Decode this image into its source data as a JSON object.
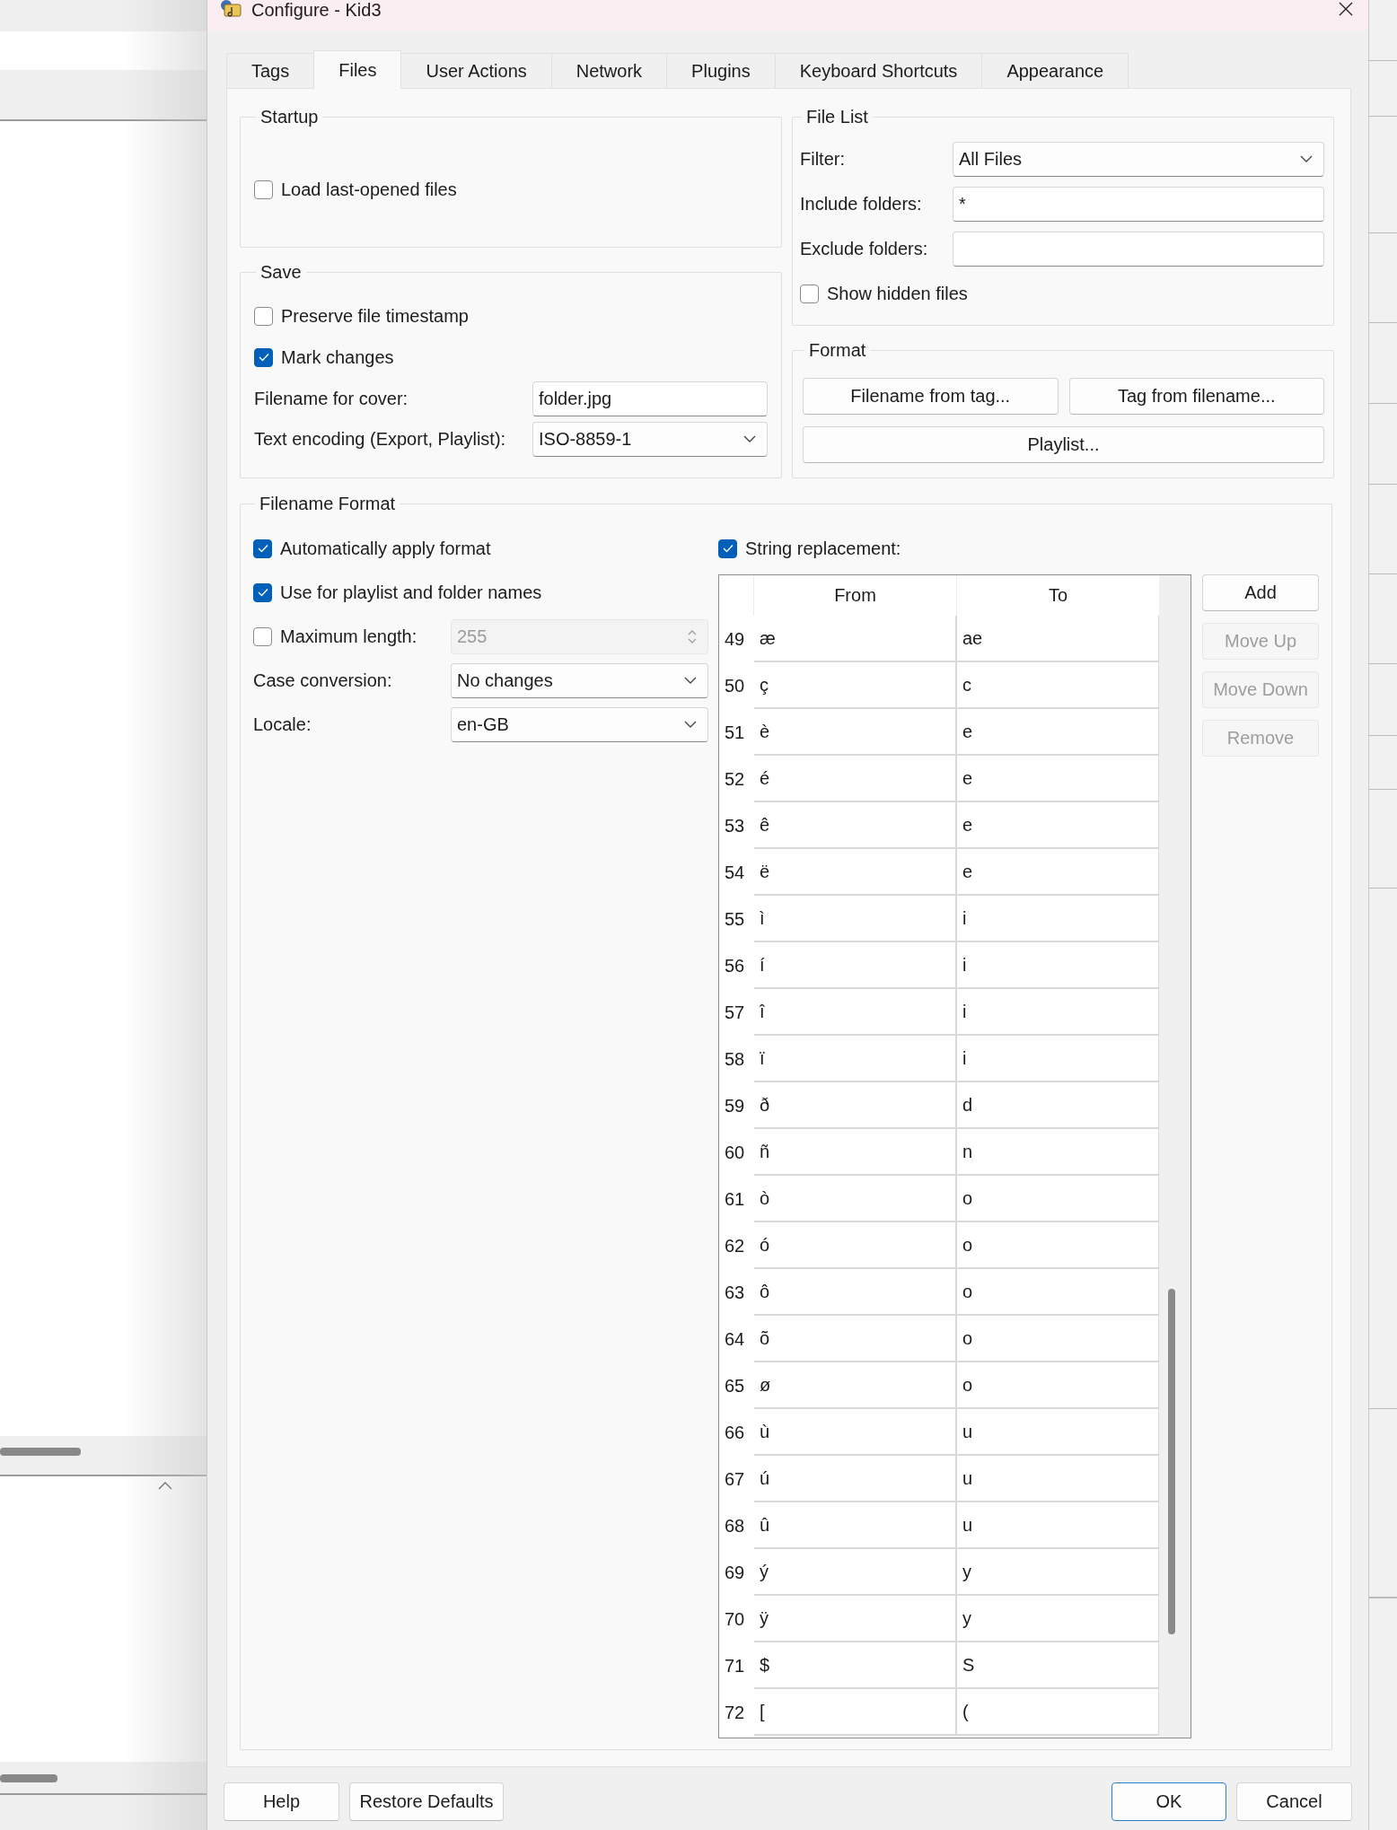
{
  "window": {
    "title": "Configure - Kid3"
  },
  "tabs": [
    {
      "label": "Tags",
      "selected": false
    },
    {
      "label": "Files",
      "selected": true
    },
    {
      "label": "User Actions",
      "selected": false
    },
    {
      "label": "Network",
      "selected": false
    },
    {
      "label": "Plugins",
      "selected": false
    },
    {
      "label": "Keyboard Shortcuts",
      "selected": false
    },
    {
      "label": "Appearance",
      "selected": false
    }
  ],
  "startup": {
    "title": "Startup",
    "options": [
      {
        "label": "Load last-opened files",
        "checked": false
      }
    ]
  },
  "save": {
    "title": "Save",
    "options": [
      {
        "label": "Preserve file timestamp",
        "checked": false
      },
      {
        "label": "Mark changes",
        "checked": true
      }
    ],
    "fields": [
      {
        "label": "Filename for cover:",
        "kind": "text",
        "value": "folder.jpg"
      },
      {
        "label": "Text encoding (Export, Playlist):",
        "kind": "combo",
        "value": "ISO-8859-1"
      }
    ]
  },
  "file_list": {
    "title": "File List",
    "fields": [
      {
        "label": "Filter:",
        "kind": "combo",
        "value": "All Files"
      },
      {
        "label": "Include folders:",
        "kind": "text",
        "value": "*"
      },
      {
        "label": "Exclude folders:",
        "kind": "text"
      }
    ],
    "options": [
      {
        "label": "Show hidden files",
        "checked": false
      }
    ]
  },
  "format": {
    "title": "Format",
    "buttons": [
      "Filename from tag...",
      "Tag from filename...",
      "Playlist..."
    ]
  },
  "filename_format": {
    "title": "Filename Format",
    "options": [
      {
        "label": "Automatically apply format",
        "checked": true
      },
      {
        "label": "Use for playlist and folder names",
        "checked": true
      }
    ],
    "max_length": {
      "label": "Maximum length:",
      "checked": false,
      "value": "255",
      "disabled": true
    },
    "fields": [
      {
        "label": "Case conversion:",
        "kind": "combo",
        "value": "No changes"
      },
      {
        "label": "Locale:",
        "kind": "combo",
        "value": "en-GB"
      }
    ],
    "string_replacement": {
      "label": "String replacement:",
      "checked": true,
      "columns": [
        "From",
        "To"
      ],
      "rows": [
        {
          "number": "49",
          "from": "æ",
          "to": "ae"
        },
        {
          "number": "50",
          "from": "ç",
          "to": "c"
        },
        {
          "number": "51",
          "from": "è",
          "to": "e"
        },
        {
          "number": "52",
          "from": "é",
          "to": "e"
        },
        {
          "number": "53",
          "from": "ê",
          "to": "e"
        },
        {
          "number": "54",
          "from": "ë",
          "to": "e"
        },
        {
          "number": "55",
          "from": "ì",
          "to": "i"
        },
        {
          "number": "56",
          "from": "í",
          "to": "i"
        },
        {
          "number": "57",
          "from": "î",
          "to": "i"
        },
        {
          "number": "58",
          "from": "ï",
          "to": "i"
        },
        {
          "number": "59",
          "from": "ð",
          "to": "d"
        },
        {
          "number": "60",
          "from": "ñ",
          "to": "n"
        },
        {
          "number": "61",
          "from": "ò",
          "to": "o"
        },
        {
          "number": "62",
          "from": "ó",
          "to": "o"
        },
        {
          "number": "63",
          "from": "ô",
          "to": "o"
        },
        {
          "number": "64",
          "from": "õ",
          "to": "o"
        },
        {
          "number": "65",
          "from": "ø",
          "to": "o"
        },
        {
          "number": "66",
          "from": "ù",
          "to": "u"
        },
        {
          "number": "67",
          "from": "ú",
          "to": "u"
        },
        {
          "number": "68",
          "from": "û",
          "to": "u"
        },
        {
          "number": "69",
          "from": "ý",
          "to": "y"
        },
        {
          "number": "70",
          "from": "ÿ",
          "to": "y"
        },
        {
          "number": "71",
          "from": "$",
          "to": "S"
        },
        {
          "number": "72",
          "from": "[",
          "to": "("
        }
      ]
    },
    "buttons": [
      {
        "label": "Add",
        "disabled": false
      },
      {
        "label": "Move Up",
        "disabled": true
      },
      {
        "label": "Move Down",
        "disabled": true
      },
      {
        "label": "Remove",
        "disabled": true
      }
    ]
  },
  "dialog_buttons": [
    {
      "label": "Help",
      "default": false
    },
    {
      "label": "Restore Defaults",
      "default": false
    },
    {
      "label": "OK",
      "default": true
    },
    {
      "label": "Cancel",
      "default": false
    }
  ]
}
